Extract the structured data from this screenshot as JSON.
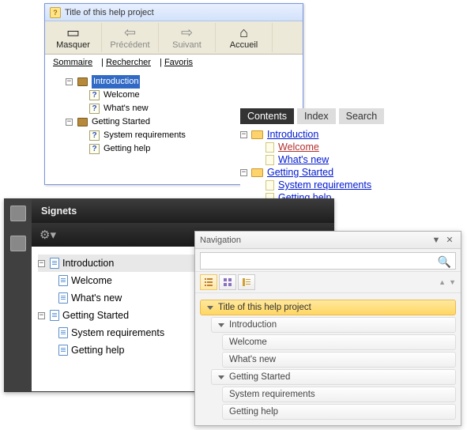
{
  "win1": {
    "title": "Title of this help project",
    "toolbar": {
      "hide": "Masquer",
      "back": "Précédent",
      "forward": "Suivant",
      "home": "Accueil"
    },
    "tabs": {
      "summary": "Sommaire",
      "search": "Rechercher",
      "favorites": "Favoris"
    },
    "tree": {
      "intro": "Introduction",
      "welcome": "Welcome",
      "whatsnew": "What's new",
      "getting": "Getting Started",
      "sysreq": "System requirements",
      "gethelp": "Getting help"
    }
  },
  "win2": {
    "tabs": {
      "contents": "Contents",
      "index": "Index",
      "search": "Search"
    },
    "tree": {
      "intro": "Introduction",
      "welcome": "Welcome",
      "whatsnew": "What's new",
      "getting": "Getting Started",
      "sysreq": "System requirements",
      "gethelp": "Getting help"
    }
  },
  "win3": {
    "header": "Signets",
    "tree": {
      "intro": "Introduction",
      "welcome": "Welcome",
      "whatsnew": "What's new",
      "getting": "Getting Started",
      "sysreq": "System requirements",
      "gethelp": "Getting help"
    }
  },
  "win4": {
    "title": "Navigation",
    "search_placeholder": "",
    "tree": {
      "root": "Title of this help project",
      "intro": "Introduction",
      "welcome": "Welcome",
      "whatsnew": "What's new",
      "getting": "Getting Started",
      "sysreq": "System requirements",
      "gethelp": "Getting help"
    }
  }
}
